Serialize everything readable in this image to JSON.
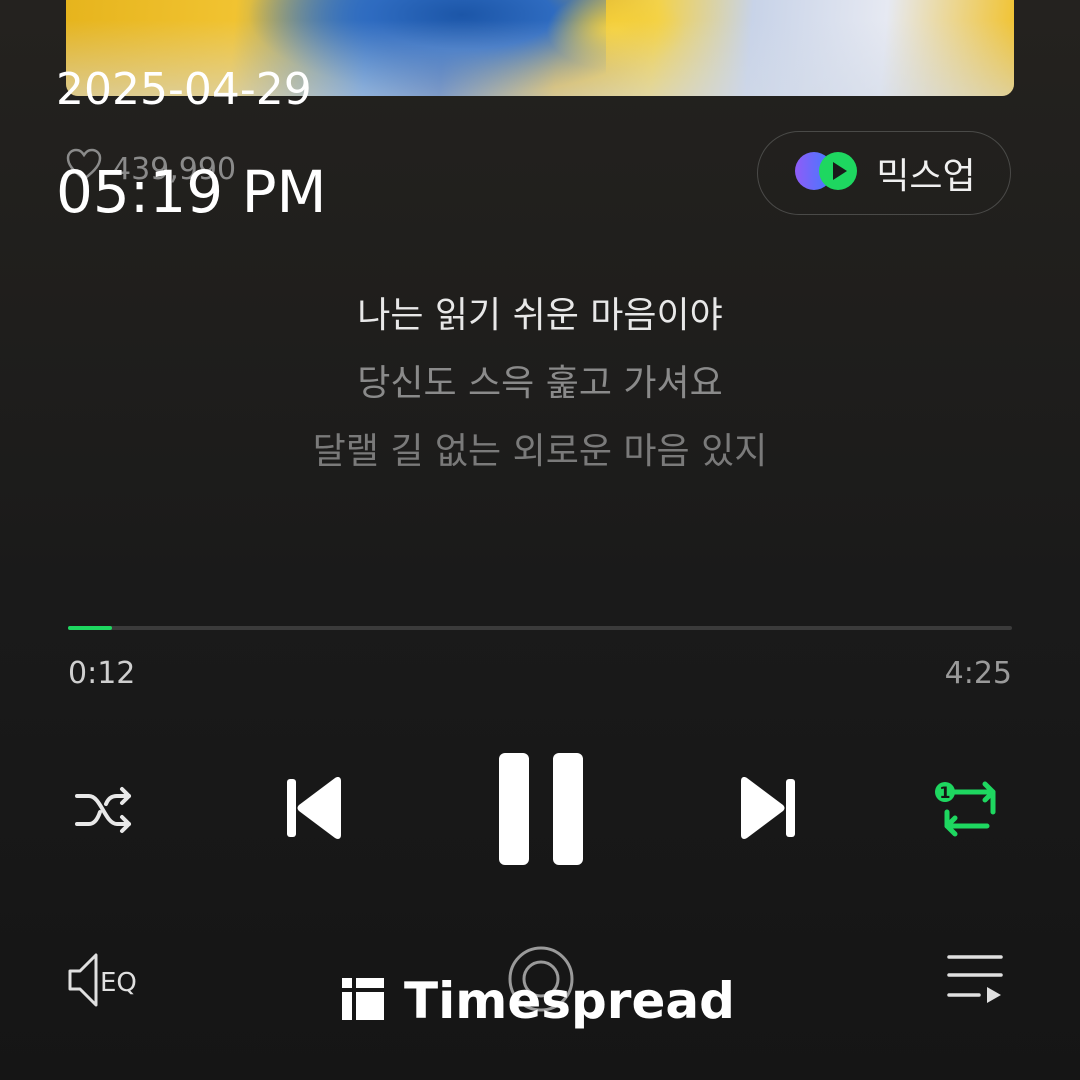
{
  "overlay": {
    "date": "2025-04-29",
    "time": "05:19 PM"
  },
  "album_art": {
    "icon": "album-art-image",
    "colors": [
      "#f1c331",
      "#1a4fa0",
      "#e6e9f2"
    ]
  },
  "likes": {
    "icon": "heart-outline-icon",
    "count": "439,990"
  },
  "mixup_button": {
    "label": "믹스업",
    "icon": "mixup-play-icon"
  },
  "lyrics": [
    {
      "text": "나는 읽기 쉬운 마음이야",
      "state": "current"
    },
    {
      "text": "당신도 스윽 훑고 가셔요",
      "state": "upcoming"
    },
    {
      "text": "달랠 길 없는 외로운 마음 있지",
      "state": "upcoming"
    }
  ],
  "playback": {
    "current_time": "0:12",
    "total_time": "4:25",
    "progress_fraction": 0.047,
    "accent_color": "#1ed760"
  },
  "controls": {
    "shuffle": {
      "icon": "shuffle-icon"
    },
    "previous": {
      "icon": "skip-previous-icon"
    },
    "play_pause": {
      "icon": "pause-icon"
    },
    "next": {
      "icon": "skip-next-icon"
    },
    "repeat": {
      "icon": "repeat-one-icon",
      "state": "repeat-one"
    }
  },
  "bottom_bar": {
    "eq": {
      "icon": "eq-icon"
    },
    "center": {
      "icon": "record-icon"
    },
    "playlist": {
      "icon": "playlist-icon"
    }
  },
  "watermark": {
    "text": "Timespread",
    "icon": "timespread-logo-icon"
  }
}
